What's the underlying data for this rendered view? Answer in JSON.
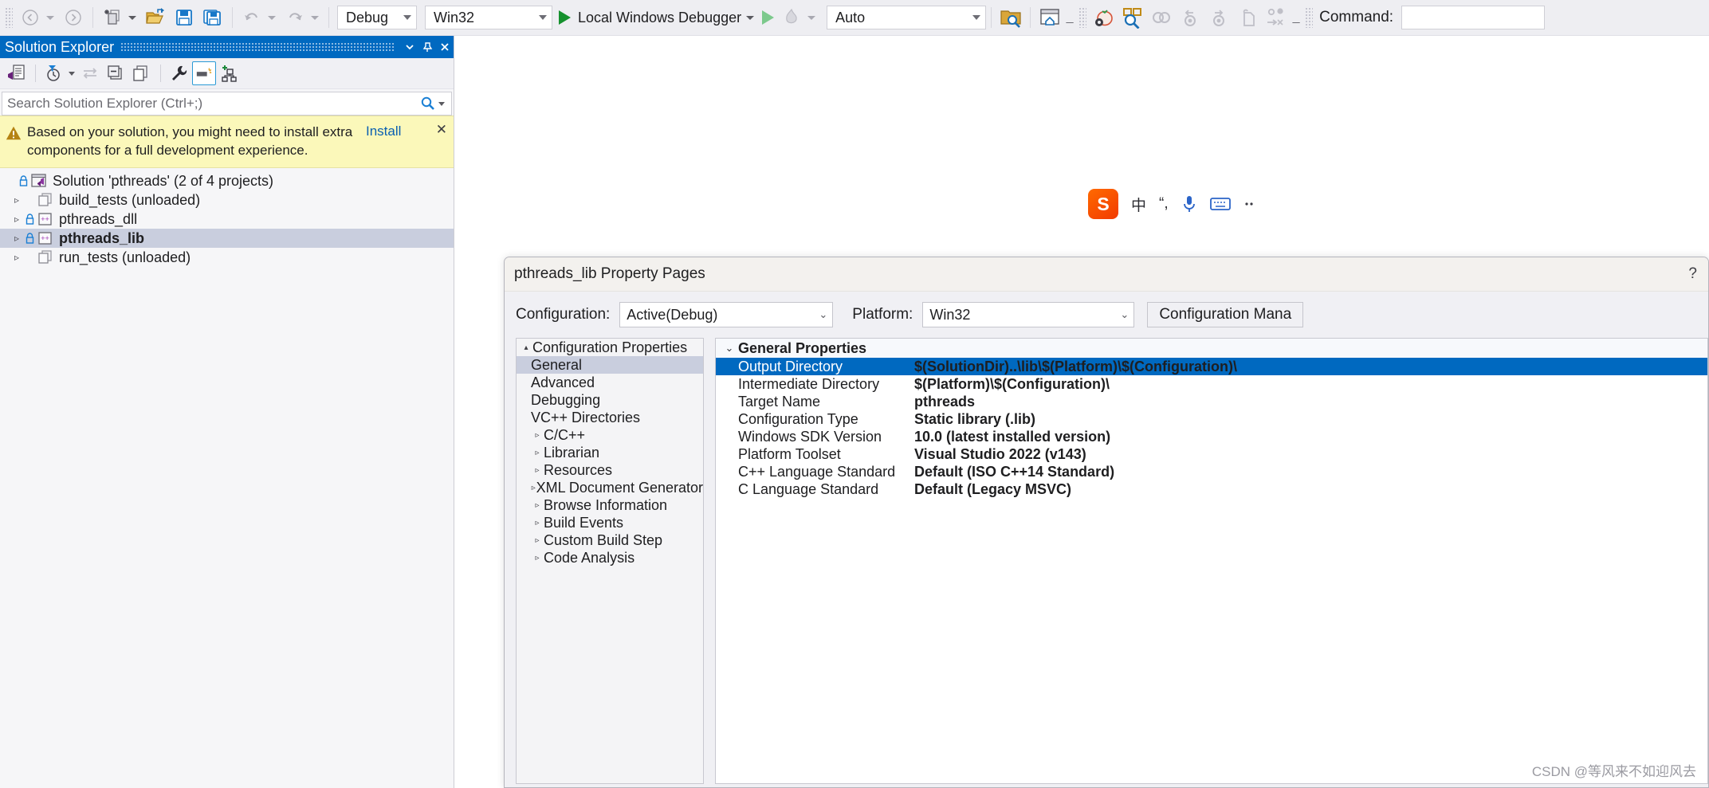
{
  "toolbar": {
    "nav_back": "navigate-back",
    "nav_forward": "navigate-forward",
    "new_item": "new-item",
    "open_file": "open-file",
    "save": "save",
    "save_all": "save-all",
    "undo": "undo",
    "redo": "redo",
    "configuration": "Debug",
    "platform": "Win32",
    "run_label": "Local Windows Debugger",
    "auto": "Auto",
    "command_label": "Command:",
    "command_value": ""
  },
  "solution_explorer": {
    "title": "Solution Explorer",
    "search_placeholder": "Search Solution Explorer (Ctrl+;)",
    "warning": {
      "text": "Based on your solution, you might need to install extra components for a full development experience.",
      "link": "Install",
      "close": "✕"
    },
    "tree": [
      {
        "label": "Solution 'pthreads' (2 of 4 projects)",
        "icon": "solution-icon",
        "lock": true,
        "expander": "",
        "indent": 0,
        "selected": false,
        "bold": false
      },
      {
        "label": "build_tests (unloaded)",
        "icon": "unloaded-project-icon",
        "lock": false,
        "expander": "▹",
        "indent": 1,
        "selected": false,
        "bold": false
      },
      {
        "label": "pthreads_dll",
        "icon": "cpp-project-icon",
        "lock": true,
        "expander": "▹",
        "indent": 1,
        "selected": false,
        "bold": false
      },
      {
        "label": "pthreads_lib",
        "icon": "cpp-project-icon",
        "lock": true,
        "expander": "▹",
        "indent": 1,
        "selected": true,
        "bold": true
      },
      {
        "label": "run_tests (unloaded)",
        "icon": "unloaded-project-icon",
        "lock": false,
        "expander": "▹",
        "indent": 1,
        "selected": false,
        "bold": false
      }
    ]
  },
  "ime": {
    "logo": "S",
    "mode": "中",
    "punct": "“,",
    "mic": "mic-icon",
    "keyboard": "keyboard-icon"
  },
  "dialog": {
    "title": "pthreads_lib Property Pages",
    "help": "?",
    "configuration_label": "Configuration:",
    "configuration_value": "Active(Debug)",
    "platform_label": "Platform:",
    "platform_value": "Win32",
    "config_manager_button": "Configuration Mana",
    "tree": [
      {
        "label": "Configuration Properties",
        "arrow": "▴",
        "level": 0,
        "selected": false
      },
      {
        "label": "General",
        "arrow": "",
        "level": 1,
        "selected": true
      },
      {
        "label": "Advanced",
        "arrow": "",
        "level": 1,
        "selected": false
      },
      {
        "label": "Debugging",
        "arrow": "",
        "level": 1,
        "selected": false
      },
      {
        "label": "VC++ Directories",
        "arrow": "",
        "level": 1,
        "selected": false
      },
      {
        "label": "C/C++",
        "arrow": "▹",
        "level": 1,
        "selected": false
      },
      {
        "label": "Librarian",
        "arrow": "▹",
        "level": 1,
        "selected": false
      },
      {
        "label": "Resources",
        "arrow": "▹",
        "level": 1,
        "selected": false
      },
      {
        "label": "XML Document Generator",
        "arrow": "▹",
        "level": 1,
        "selected": false
      },
      {
        "label": "Browse Information",
        "arrow": "▹",
        "level": 1,
        "selected": false
      },
      {
        "label": "Build Events",
        "arrow": "▹",
        "level": 1,
        "selected": false
      },
      {
        "label": "Custom Build Step",
        "arrow": "▹",
        "level": 1,
        "selected": false
      },
      {
        "label": "Code Analysis",
        "arrow": "▹",
        "level": 1,
        "selected": false
      }
    ],
    "grid": {
      "category": "General Properties",
      "category_chevron": "⌄",
      "rows": [
        {
          "name": "Output Directory",
          "value": "$(SolutionDir)..\\lib\\$(Platform)\\$(Configuration)\\",
          "selected": true
        },
        {
          "name": "Intermediate Directory",
          "value": "$(Platform)\\$(Configuration)\\",
          "selected": false
        },
        {
          "name": "Target Name",
          "value": "pthreads",
          "selected": false
        },
        {
          "name": "Configuration Type",
          "value": "Static library (.lib)",
          "selected": false
        },
        {
          "name": "Windows SDK Version",
          "value": "10.0 (latest installed version)",
          "selected": false
        },
        {
          "name": "Platform Toolset",
          "value": "Visual Studio 2022 (v143)",
          "selected": false
        },
        {
          "name": "C++ Language Standard",
          "value": "Default (ISO C++14 Standard)",
          "selected": false
        },
        {
          "name": "C Language Standard",
          "value": "Default (Legacy MSVC)",
          "selected": false
        }
      ]
    }
  },
  "watermark": "CSDN @等风来不如迎风去"
}
